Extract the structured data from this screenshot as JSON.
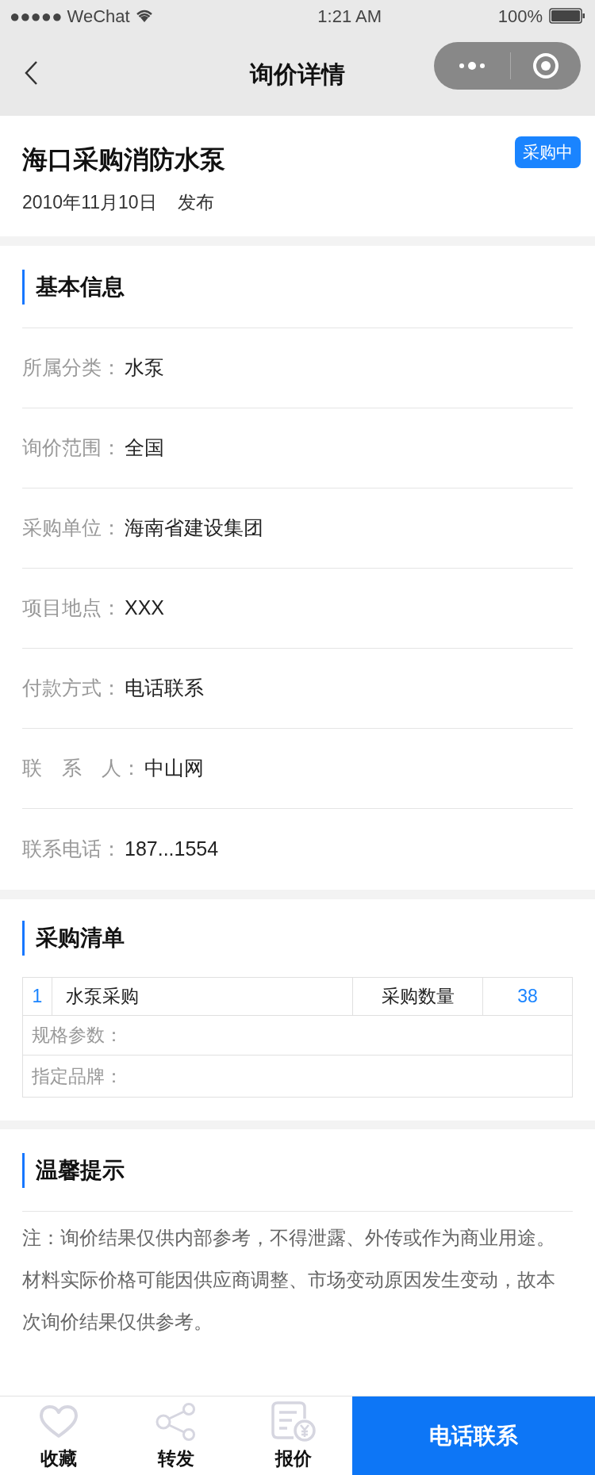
{
  "status_bar": {
    "carrier": "●●●●● WeChat",
    "time": "1:21 AM",
    "battery": "100%"
  },
  "nav": {
    "title": "询价详情"
  },
  "header": {
    "title": "海口采购消防水泵",
    "date": "2010年11月10日",
    "action": "发布",
    "badge": "采购中"
  },
  "basic_info": {
    "title": "基本信息",
    "rows": [
      {
        "label": "所属分类：",
        "value": "水泵"
      },
      {
        "label": "询价范围：",
        "value": "全国"
      },
      {
        "label": "采购单位：",
        "value": "海南省建设集团"
      },
      {
        "label": "项目地点：",
        "value": "XXX"
      },
      {
        "label": "付款方式：",
        "value": "电话联系"
      },
      {
        "label": "联　系　人：",
        "value": "中山网"
      },
      {
        "label": "联系电话：",
        "value": "187...1554"
      }
    ]
  },
  "purchase_list": {
    "title": "采购清单",
    "items": [
      {
        "index": "1",
        "name": "水泵采购",
        "qty_label": "采购数量",
        "qty": "38",
        "spec": "规格参数：",
        "brand": "指定品牌："
      }
    ]
  },
  "notice": {
    "title": "温馨提示",
    "text": "注：询价结果仅供内部参考，不得泄露、外传或作为商业用途。材料实际价格可能因供应商调整、市场变动原因发生变动，故本次询价结果仅供参考。"
  },
  "bottom_bar": {
    "tabs": [
      {
        "kind": "heart",
        "label": "收藏"
      },
      {
        "kind": "share",
        "label": "转发"
      },
      {
        "kind": "quote",
        "label": "报价"
      }
    ],
    "call_button": "电话联系"
  }
}
